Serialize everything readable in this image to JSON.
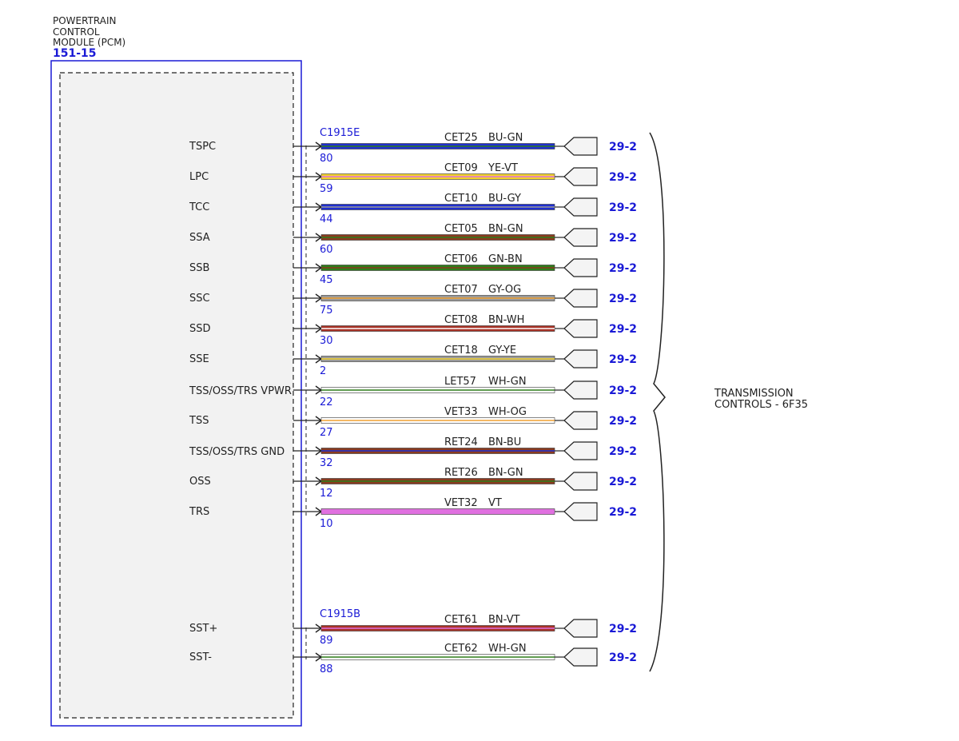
{
  "module": {
    "title_lines": [
      "POWERTRAIN",
      "CONTROL",
      "MODULE (PCM)"
    ],
    "ref": "151-15"
  },
  "connectors": [
    "C1915E",
    "C1915B"
  ],
  "target": {
    "lines": [
      "TRANSMISSION",
      "CONTROLS - 6F35"
    ]
  },
  "colors": {
    "BU": "#1f2fd0",
    "GN": "#2e7d1a",
    "YE": "#f2d22c",
    "VT": "#e070e0",
    "GY": "#9a9a9a",
    "BN": "#8a3a1e",
    "OG": "#f0a030",
    "WH": "#ffffff",
    "border": "#1a1ad6"
  },
  "circuits": [
    {
      "signal": "TSPC",
      "pin": "80",
      "circuit": "CET25",
      "color": "BU-GN",
      "ref": "29-2",
      "base": "#1f2fd0",
      "stripe": "#2e7d1a"
    },
    {
      "signal": "LPC",
      "pin": "59",
      "circuit": "CET09",
      "color": "YE-VT",
      "ref": "29-2",
      "base": "#f2d22c",
      "stripe": "#e070e0"
    },
    {
      "signal": "TCC",
      "pin": "44",
      "circuit": "CET10",
      "color": "BU-GY",
      "ref": "29-2",
      "base": "#1f2fd0",
      "stripe": "#9a9a9a"
    },
    {
      "signal": "SSA",
      "pin": "60",
      "circuit": "CET05",
      "color": "BN-GN",
      "ref": "29-2",
      "base": "#8a3a1e",
      "stripe": "#2e7d1a"
    },
    {
      "signal": "SSB",
      "pin": "45",
      "circuit": "CET06",
      "color": "GN-BN",
      "ref": "29-2",
      "base": "#2e7d1a",
      "stripe": "#8a3a1e"
    },
    {
      "signal": "SSC",
      "pin": "75",
      "circuit": "CET07",
      "color": "GY-OG",
      "ref": "29-2",
      "base": "#9a9a9a",
      "stripe": "#f0a030"
    },
    {
      "signal": "SSD",
      "pin": "30",
      "circuit": "CET08",
      "color": "BN-WH",
      "ref": "29-2",
      "base": "#a83226",
      "stripe": "#ffffff"
    },
    {
      "signal": "SSE",
      "pin": "2",
      "circuit": "CET18",
      "color": "GY-YE",
      "ref": "29-2",
      "base": "#9a9a9a",
      "stripe": "#f2d22c"
    },
    {
      "signal": "TSS/OSS/TRS VPWR",
      "pin": "22",
      "circuit": "LET57",
      "color": "WH-GN",
      "ref": "29-2",
      "base": "#ffffff",
      "stripe": "#2e7d1a"
    },
    {
      "signal": "TSS",
      "pin": "27",
      "circuit": "VET33",
      "color": "WH-OG",
      "ref": "29-2",
      "base": "#ffffff",
      "stripe": "#f0a030"
    },
    {
      "signal": "TSS/OSS/TRS GND",
      "pin": "32",
      "circuit": "RET24",
      "color": "BN-BU",
      "ref": "29-2",
      "base": "#8a3a1e",
      "stripe": "#1f2fd0"
    },
    {
      "signal": "OSS",
      "pin": "12",
      "circuit": "RET26",
      "color": "BN-GN",
      "ref": "29-2",
      "base": "#8a3a1e",
      "stripe": "#2e7d1a"
    },
    {
      "signal": "TRS",
      "pin": "10",
      "circuit": "VET32",
      "color": "VT",
      "ref": "29-2",
      "base": "#e070e0",
      "stripe": "#e070e0"
    },
    {
      "signal": "SST+",
      "pin": "89",
      "circuit": "CET61",
      "color": "BN-VT",
      "ref": "29-2",
      "base": "#a83226",
      "stripe": "#e070e0"
    },
    {
      "signal": "SST-",
      "pin": "88",
      "circuit": "CET62",
      "color": "WH-GN",
      "ref": "29-2",
      "base": "#ffffff",
      "stripe": "#2e7d1a"
    }
  ]
}
